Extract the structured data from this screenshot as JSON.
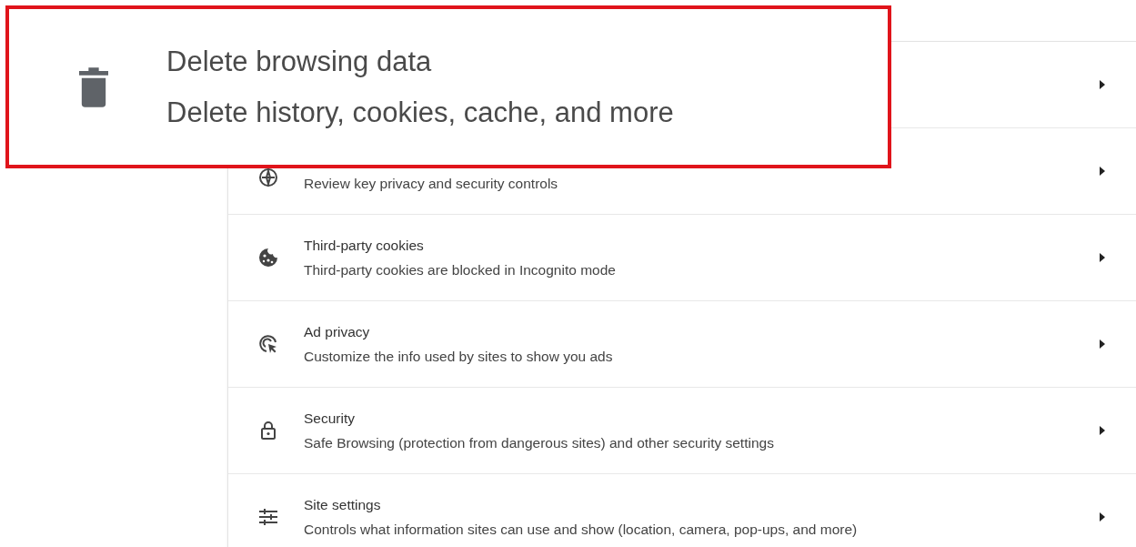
{
  "callout": {
    "title": "Delete browsing data",
    "subtitle": "Delete history, cookies, cache, and more"
  },
  "rows": [
    {
      "arrow": true
    },
    {
      "subtitle": "Review key privacy and security controls",
      "arrow": true
    },
    {
      "title": "Third-party cookies",
      "subtitle": "Third-party cookies are blocked in Incognito mode",
      "arrow": true
    },
    {
      "title": "Ad privacy",
      "subtitle": "Customize the info used by sites to show you ads",
      "arrow": true
    },
    {
      "title": "Security",
      "subtitle": "Safe Browsing (protection from dangerous sites) and other security settings",
      "arrow": true
    },
    {
      "title": "Site settings",
      "subtitle": "Controls what information sites can use and show (location, camera, pop-ups, and more)",
      "arrow": true
    }
  ]
}
